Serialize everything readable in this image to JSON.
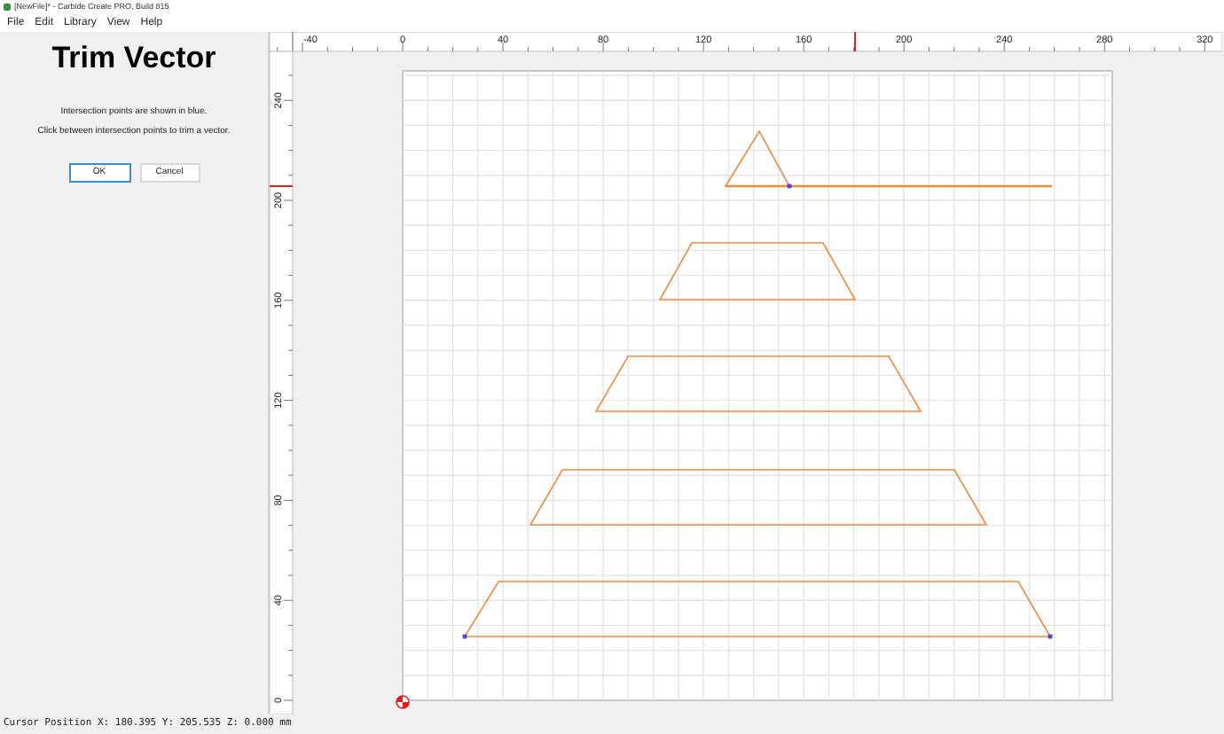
{
  "window": {
    "title": "[NewFile]* - Carbide Create PRO, Build 815"
  },
  "menu": [
    {
      "label": "File"
    },
    {
      "label": "Edit"
    },
    {
      "label": "Library"
    },
    {
      "label": "View"
    },
    {
      "label": "Help"
    }
  ],
  "panel": {
    "title": "Trim Vector",
    "instructions": [
      "Intersection points are shown in blue.",
      "Click between intersection points to trim a vector."
    ],
    "buttons": [
      {
        "label": "OK",
        "default": true
      },
      {
        "label": "Cancel",
        "default": false
      }
    ]
  },
  "rulers": {
    "x_labels": [
      "-40",
      "0",
      "40",
      "80",
      "120",
      "160",
      "200",
      "240",
      "280",
      "320"
    ],
    "y_labels": [
      "0",
      "40",
      "80",
      "120",
      "160",
      "200",
      "240"
    ]
  },
  "status_bar": "Cursor Position X: 180.395 Y: 205.535 Z: 0.000 mm"
}
